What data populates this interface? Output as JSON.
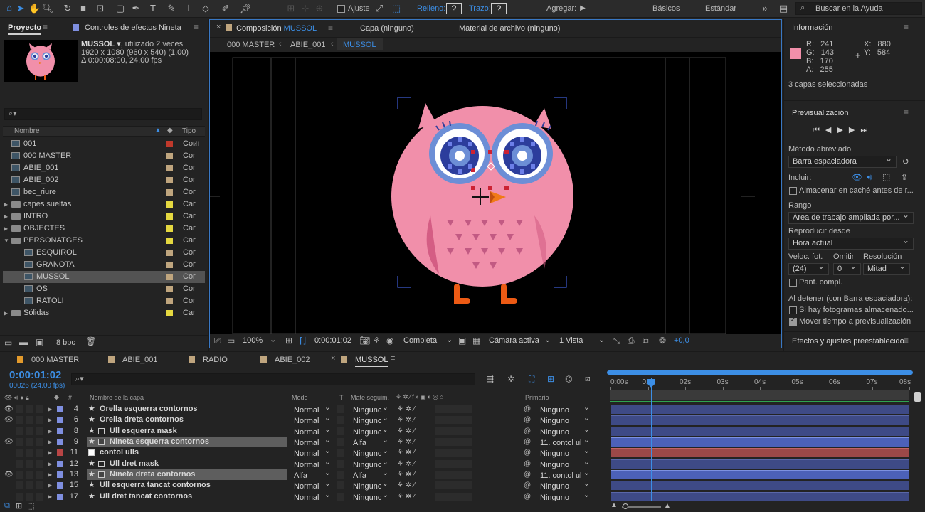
{
  "toolbar": {
    "ajuste_label": "Ajuste",
    "relleno_label": "Relleno:",
    "trazo_label": "Trazo:",
    "agregar_label": "Agregar:",
    "workspace_basicos": "Básicos",
    "workspace_estandar": "Estándar",
    "search_placeholder": "Buscar en la Ayuda"
  },
  "project": {
    "tab_label": "Proyecto",
    "effects_tab_label": "Controles de efectos Nineta",
    "thumb_name": "MUSSOL",
    "thumb_usage": ", utilizado 2 veces",
    "thumb_dims": "1920 x 1080  (960 x 540) (1,00)",
    "thumb_duration": "Δ 0:00:08:00, 24,00 fps",
    "col_name": "Nombre",
    "col_type": "Tipo",
    "bpc": "8 bpc",
    "items": [
      {
        "name": "001",
        "label": "#c0392b",
        "type": "Cor",
        "kind": "comp",
        "indent": 0
      },
      {
        "name": "000 MASTER",
        "label": "#bfa57e",
        "type": "Cor",
        "kind": "comp",
        "indent": 0
      },
      {
        "name": "ABIE_001",
        "label": "#bfa57e",
        "type": "Cor",
        "kind": "comp",
        "indent": 0
      },
      {
        "name": "ABIE_002",
        "label": "#bfa57e",
        "type": "Cor",
        "kind": "comp",
        "indent": 0
      },
      {
        "name": "bec_riure",
        "label": "#bfa57e",
        "type": "Cor",
        "kind": "comp",
        "indent": 0
      },
      {
        "name": "capes sueltas",
        "label": "#e5d840",
        "type": "Car",
        "kind": "folder",
        "indent": 0
      },
      {
        "name": "INTRO",
        "label": "#e5d840",
        "type": "Car",
        "kind": "folder",
        "indent": 0
      },
      {
        "name": "OBJECTES",
        "label": "#e5d840",
        "type": "Car",
        "kind": "folder",
        "indent": 0
      },
      {
        "name": "PERSONATGES",
        "label": "#e5d840",
        "type": "Car",
        "kind": "folder-open",
        "indent": 0
      },
      {
        "name": "ESQUIROL",
        "label": "#bfa57e",
        "type": "Cor",
        "kind": "comp",
        "indent": 1
      },
      {
        "name": "GRANOTA",
        "label": "#bfa57e",
        "type": "Cor",
        "kind": "comp",
        "indent": 1
      },
      {
        "name": "MUSSOL",
        "label": "#bfa57e",
        "type": "Cor",
        "kind": "comp",
        "indent": 1,
        "selected": true
      },
      {
        "name": "OS",
        "label": "#bfa57e",
        "type": "Cor",
        "kind": "comp",
        "indent": 1
      },
      {
        "name": "RATOLI",
        "label": "#bfa57e",
        "type": "Cor",
        "kind": "comp",
        "indent": 1
      },
      {
        "name": "Sólidas",
        "label": "#e5d840",
        "type": "Car",
        "kind": "folder",
        "indent": 0
      }
    ]
  },
  "composition": {
    "tab_label": "Composición",
    "comp_name": "MUSSOL",
    "layer_tab": "Capa (ninguno)",
    "footage_tab": "Material de archivo (ninguno)",
    "breadcrumbs": [
      "000 MASTER",
      "ABIE_001",
      "MUSSOL"
    ],
    "zoom": "100%",
    "timecode": "0:00:01:02",
    "resolution": "Completa",
    "camera": "Cámara activa",
    "views": "1 Vista",
    "exposure": "+0,0"
  },
  "info": {
    "title": "Información",
    "r_label": "R:",
    "r": "241",
    "g_label": "G:",
    "g": "143",
    "b_label": "B:",
    "b": "170",
    "a_label": "A:",
    "a": "255",
    "x_label": "X:",
    "x": "880",
    "y_label": "Y:",
    "y": "584",
    "sample_color": "#f18faa",
    "selection": "3 capas seleccionadas"
  },
  "preview": {
    "title": "Previsualización",
    "shortcut_label": "Método abreviado",
    "shortcut_value": "Barra espaciadora",
    "include_label": "Incluir:",
    "cache_label": "Almacenar en caché antes de r...",
    "range_label": "Rango",
    "range_value": "Área de trabajo ampliada por...",
    "play_from_label": "Reproducir desde",
    "play_from_value": "Hora actual",
    "fps_label": "Veloc. fot.",
    "skip_label": "Omitir",
    "res_label": "Resolución",
    "fps_value": "(24)",
    "skip_value": "0",
    "res_value": "Mitad",
    "fullscreen_label": "Pant. compl.",
    "stop_label": "Al detener (con Barra espaciadora):",
    "cached_label": "Si hay fotogramas almacenado...",
    "move_time_label": "Mover tiempo a previsualización"
  },
  "effects_panel": {
    "title": "Efectos y ajustes preestablecido"
  },
  "timeline": {
    "tabs": [
      {
        "label": "000 MASTER",
        "color": "#e39a2c"
      },
      {
        "label": "ABIE_001",
        "color": "#bfa57e"
      },
      {
        "label": "RADIO",
        "color": "#bfa57e"
      },
      {
        "label": "ABIE_002",
        "color": "#bfa57e"
      },
      {
        "label": "MUSSOL",
        "color": "#bfa57e",
        "active": true
      }
    ],
    "timecode": "0:00:01:02",
    "frame_info": "00026 (24.00 fps)",
    "headers": {
      "name": "Nombre de la capa",
      "mode": "Modo",
      "t": "T",
      "track": "Mate seguim.",
      "parent": "Primario",
      "num": "#"
    },
    "ruler": [
      "0:00s",
      "01s",
      "02s",
      "03s",
      "04s",
      "05s",
      "06s",
      "07s",
      "08s"
    ],
    "playhead_time": 1.08,
    "duration": 8,
    "layers": [
      {
        "num": "4",
        "name": "Orella esquerra contornos",
        "label": "#7f8fe0",
        "kind": "shape",
        "mode": "Normal",
        "track": "Ningunc",
        "parent": "Ninguno",
        "bar": "blue",
        "eye": true
      },
      {
        "num": "6",
        "name": "Orella dreta contornos",
        "label": "#7f8fe0",
        "kind": "shape",
        "mode": "Normal",
        "track": "Ningunc",
        "parent": "Ninguno",
        "bar": "blue",
        "eye": true
      },
      {
        "num": "8",
        "name": "Ull esquerra mask",
        "label": "#7f8fe0",
        "kind": "comp",
        "mode": "Normal",
        "track": "Ningunc",
        "parent": "Ninguno",
        "bar": "blue",
        "eye": false
      },
      {
        "num": "9",
        "name": "Nineta esquerra contornos",
        "label": "#7f8fe0",
        "kind": "shape",
        "mode": "Normal",
        "track": "Alfa",
        "parent": "11. contol ul",
        "bar": "blue",
        "eye": true,
        "selected": true
      },
      {
        "num": "11",
        "name": "contol ulls",
        "label": "#b84545",
        "kind": "null",
        "mode": "Normal",
        "track": "Ningunc",
        "parent": "Ninguno",
        "bar": "red",
        "eye": false
      },
      {
        "num": "12",
        "name": "Ull dret mask",
        "label": "#7f8fe0",
        "kind": "comp",
        "mode": "Normal",
        "track": "Ningunc",
        "parent": "Ninguno",
        "bar": "blue",
        "eye": false
      },
      {
        "num": "13",
        "name": "Nineta dreta contornos",
        "label": "#7f8fe0",
        "kind": "shape",
        "mode": "Alfa",
        "track": "Alfa",
        "parent": "11. contol ul",
        "bar": "blue",
        "eye": true,
        "selected": true
      },
      {
        "num": "15",
        "name": "Ull esquerra tancat contornos",
        "label": "#7f8fe0",
        "kind": "shape",
        "mode": "Normal",
        "track": "Ningunc",
        "parent": "Ninguno",
        "bar": "blue",
        "eye": false
      },
      {
        "num": "17",
        "name": "Ull dret tancat contornos",
        "label": "#7f8fe0",
        "kind": "shape",
        "mode": "Normal",
        "track": "Ningunc",
        "parent": "Ninguno",
        "bar": "blue",
        "eye": false
      }
    ]
  }
}
